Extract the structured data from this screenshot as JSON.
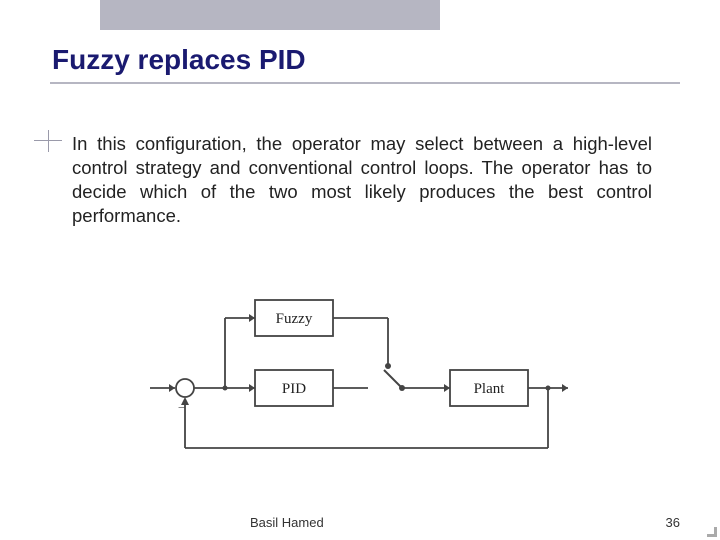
{
  "header": {
    "title": "Fuzzy replaces PID"
  },
  "body": {
    "text": "In this configuration, the operator may select between a high-level control strategy and conventional control loops. The operator has to decide which of the two most likely produces the best control performance."
  },
  "diagram": {
    "blocks": {
      "fuzzy": "Fuzzy",
      "pid": "PID",
      "plant": "Plant"
    },
    "minus_label": "−"
  },
  "footer": {
    "author": "Basil Hamed",
    "page": "36"
  }
}
